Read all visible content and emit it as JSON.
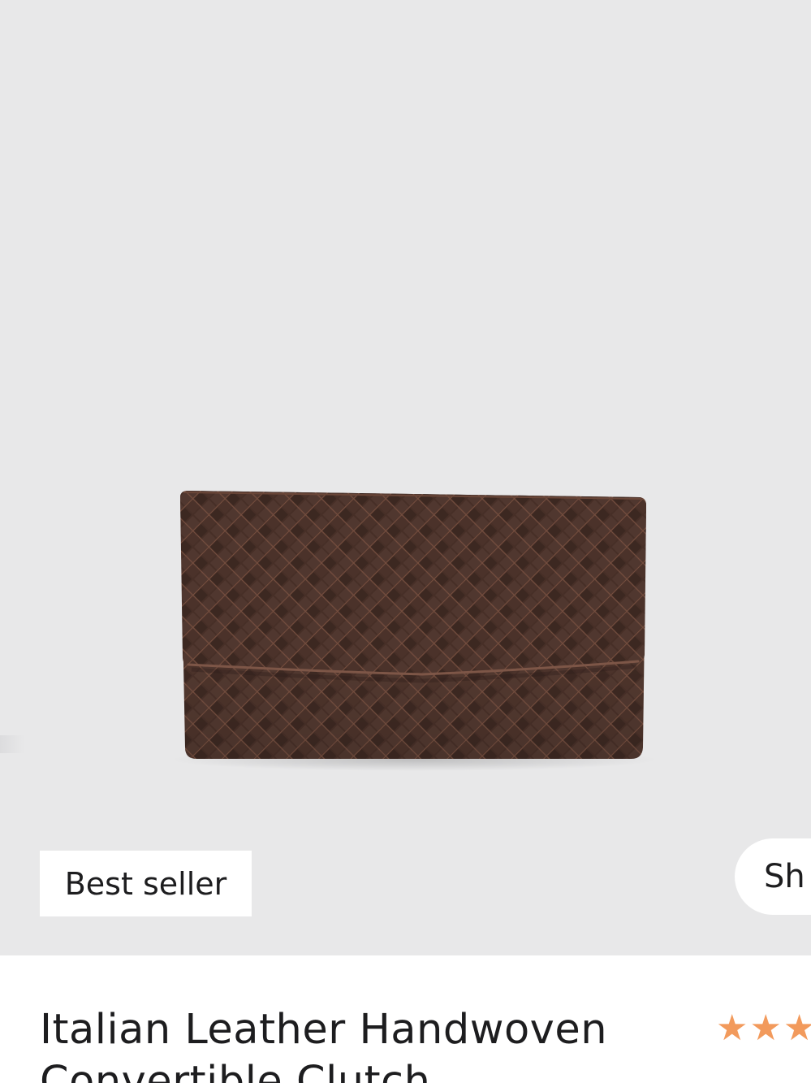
{
  "product": {
    "badge": "Best seller",
    "shop_button_label": "Sh",
    "title": "Italian Leather Handwoven Convertible Clutch",
    "rating_stars": "★★★",
    "rating_value": 3
  },
  "colors": {
    "image_background": "#e8e8e9",
    "leather": "#4a3129",
    "star": "#f29a5c"
  }
}
